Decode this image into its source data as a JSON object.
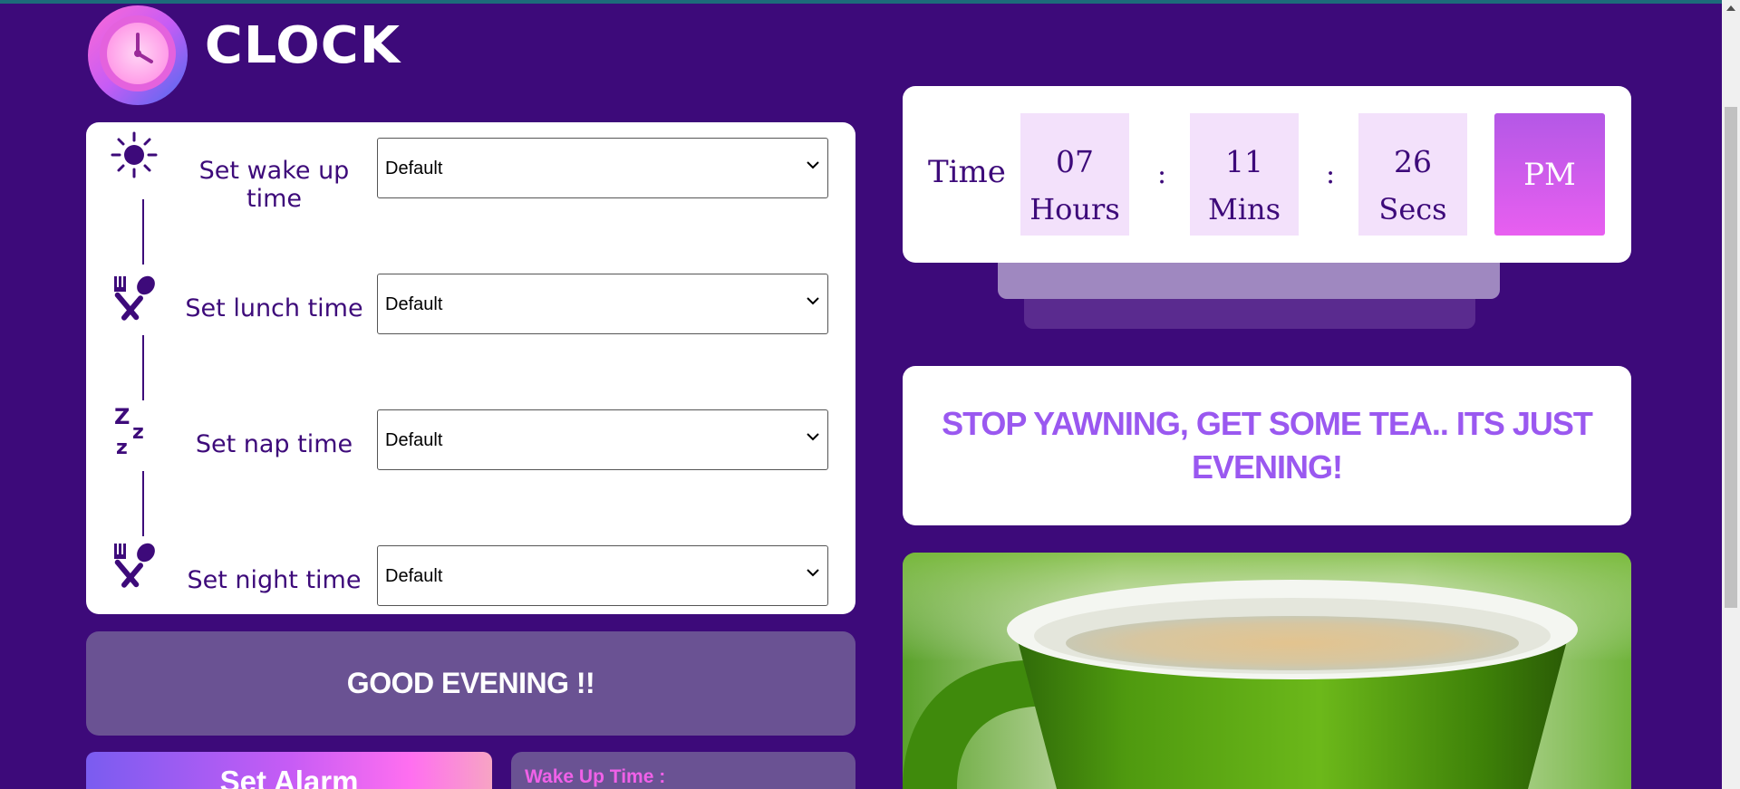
{
  "app": {
    "logo_text": "CLOCK"
  },
  "schedule": {
    "rows": [
      {
        "icon": "sun-icon",
        "label": "Set wake up time",
        "selected": "Default"
      },
      {
        "icon": "fork-spoon-icon",
        "label": "Set lunch time",
        "selected": "Default"
      },
      {
        "icon": "sleep-zzz-icon",
        "label": "Set nap time",
        "selected": "Default"
      },
      {
        "icon": "fork-spoon-icon",
        "label": "Set night time",
        "selected": "Default"
      }
    ]
  },
  "greeting": "GOOD EVENING !!",
  "alarm": {
    "button_label": "Set Alarm",
    "wake_up_label": "Wake Up Time :"
  },
  "clock": {
    "time_label": "Time",
    "hours": "07",
    "hours_unit": "Hours",
    "mins": "11",
    "mins_unit": "Mins",
    "secs": "26",
    "secs_unit": "Secs",
    "separator": ":",
    "ampm": "PM"
  },
  "message": "STOP YAWNING, GET SOME TEA.. ITS JUST EVENING!",
  "colors": {
    "background": "#3d0a7a",
    "accent": "#9a58f0",
    "pink": "#e85ff0"
  }
}
